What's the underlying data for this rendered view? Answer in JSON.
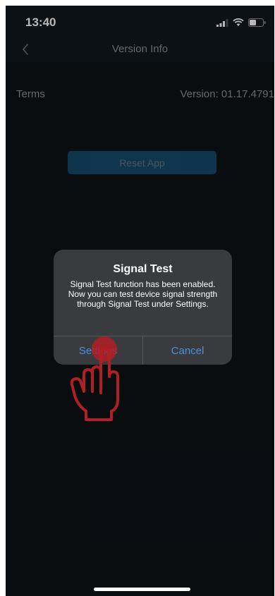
{
  "status_bar": {
    "time": "13:40"
  },
  "nav": {
    "title": "Version Info",
    "back_icon": "chevron-left-icon"
  },
  "info": {
    "terms_label": "Terms",
    "version_label": "Version: 01.17.4791"
  },
  "reset_button": {
    "label": "Reset App"
  },
  "alert": {
    "title": "Signal Test",
    "message": "Signal Test function has been enabled. Now you can test device signal strength through Signal Test under Settings.",
    "primary_label": "Settings",
    "secondary_label": "Cancel"
  },
  "colors": {
    "background": "#0d1217",
    "nav_background": "#11181f",
    "accent_blue": "#4a90e2",
    "button_blue": "#1d6ea1",
    "alert_background": "#3a3b3e",
    "tap_indicator": "#b01f24"
  },
  "overlay": {
    "icon": "tap-hand-icon"
  }
}
